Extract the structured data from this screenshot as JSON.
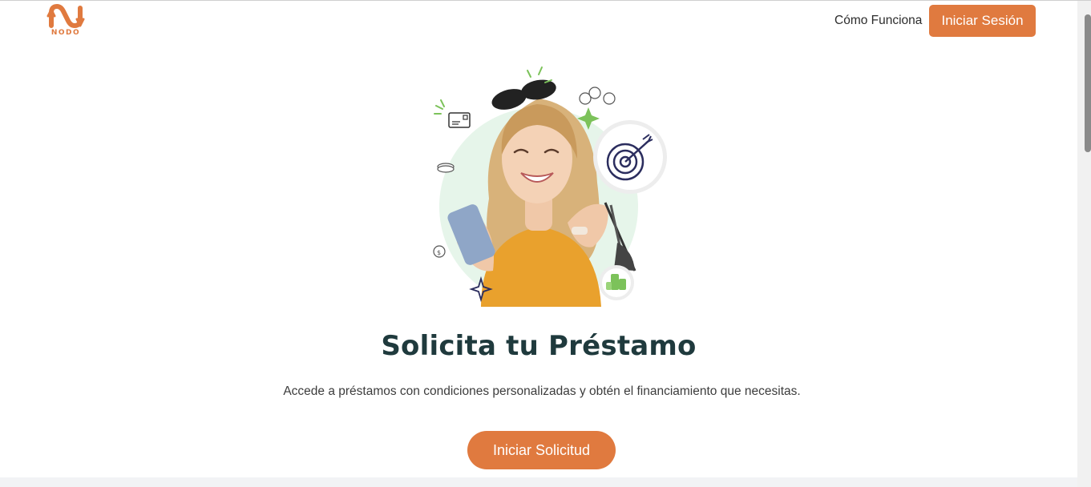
{
  "header": {
    "logo_text": "NODO",
    "nav_link": "Cómo Funciona",
    "login_label": "Iniciar Sesión"
  },
  "hero": {
    "title": "Solicita tu Préstamo",
    "subtitle": "Accede a préstamos con condiciones personalizadas y obtén el financiamiento que necesitas.",
    "cta_label": "Iniciar Solicitud",
    "illustration": "woman-smiling-phone-shopping-bags-icon"
  },
  "colors": {
    "accent": "#e07a3f",
    "title": "#1f3a3d",
    "circle_bg": "#e6f5ea",
    "icon_green": "#7cc25a",
    "icon_navy": "#2b2d5e"
  }
}
